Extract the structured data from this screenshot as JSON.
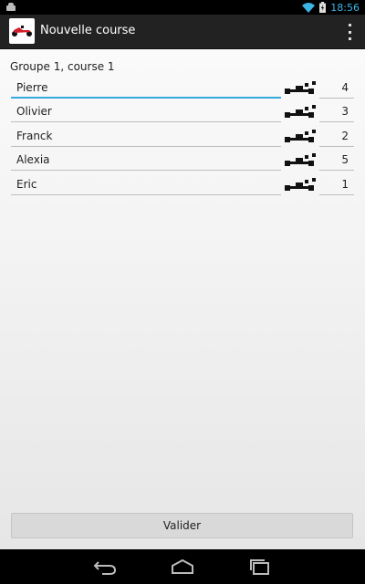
{
  "status_bar": {
    "time": "18:56"
  },
  "action_bar": {
    "title": "Nouvelle course"
  },
  "group_title": "Groupe 1, course 1",
  "rows": [
    {
      "name": "Pierre",
      "position": "4",
      "focused": true
    },
    {
      "name": "Olivier",
      "position": "3",
      "focused": false
    },
    {
      "name": "Franck",
      "position": "2",
      "focused": false
    },
    {
      "name": "Alexia",
      "position": "5",
      "focused": false
    },
    {
      "name": "Eric",
      "position": "1",
      "focused": false
    }
  ],
  "validate_label": "Valider",
  "colors": {
    "accent": "#33a9dc",
    "status_time": "#3cb4e6",
    "kart_red": "#d0202a"
  }
}
